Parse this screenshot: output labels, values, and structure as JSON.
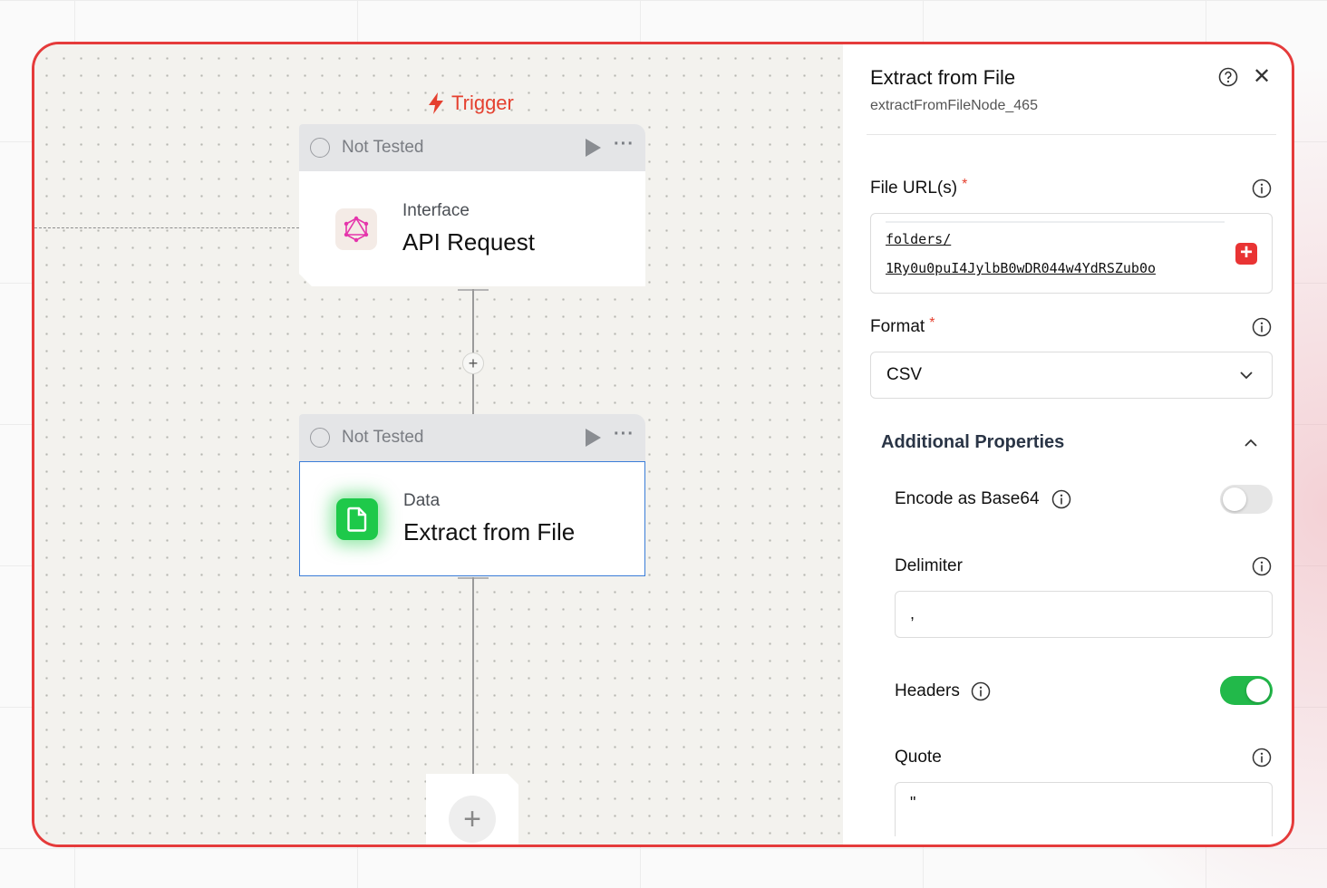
{
  "canvas": {
    "trigger_label": "Trigger",
    "nodes": [
      {
        "status": "Not Tested",
        "category": "Interface",
        "title": "API Request",
        "icon": "graphql-icon"
      },
      {
        "status": "Not Tested",
        "category": "Data",
        "title": "Extract from File",
        "icon": "file-icon"
      }
    ],
    "add_step_symbol": "+"
  },
  "panel": {
    "title": "Extract from File",
    "node_id": "extractFromFileNode_465",
    "file_urls": {
      "label": "File URL(s)",
      "required_mark": "*",
      "value_line1": "folders/",
      "value_line2": "1Ry0u0puI4JylbB0wDR044w4YdRSZub0o",
      "add_symbol": "+"
    },
    "format": {
      "label": "Format",
      "required_mark": "*",
      "value": "CSV"
    },
    "additional_properties": {
      "title": "Additional Properties",
      "encode_base64": {
        "label": "Encode as Base64",
        "enabled": false
      },
      "delimiter": {
        "label": "Delimiter",
        "value": ","
      },
      "headers": {
        "label": "Headers",
        "enabled": true
      },
      "quote": {
        "label": "Quote",
        "value": "\""
      }
    }
  },
  "colors": {
    "frame_border": "#e53b3b",
    "trigger": "#e5402f",
    "toggle_on": "#22b94a",
    "selected_border": "#3b7dd8",
    "file_icon_bg": "#1ec94a"
  }
}
